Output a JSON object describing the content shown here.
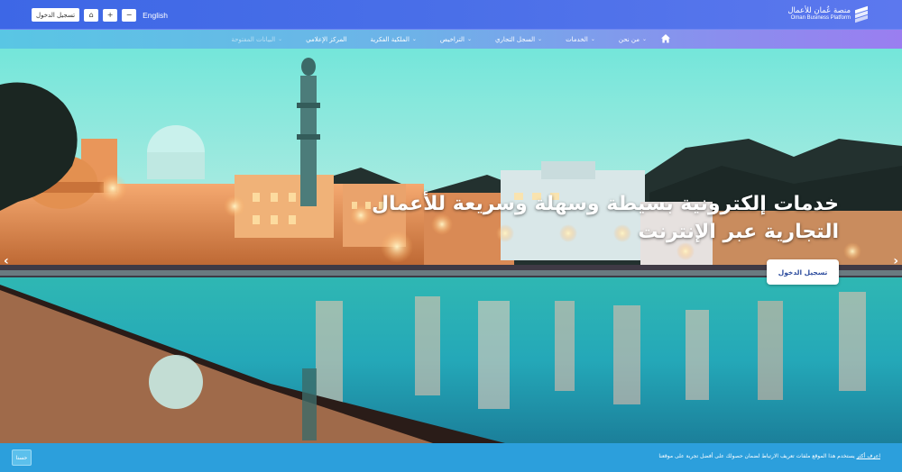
{
  "header": {
    "login_label": "تسجيل الدخول",
    "font_increase": "+",
    "font_decrease": "−",
    "home_small": "⌂",
    "language": "English",
    "logo_ar": "منصة عُمان للأعمال",
    "logo_en": "Oman Business Platform"
  },
  "nav": {
    "items": [
      {
        "label": "من نحن",
        "has_menu": true
      },
      {
        "label": "الخدمات",
        "has_menu": true
      },
      {
        "label": "السجل التجاري",
        "has_menu": true
      },
      {
        "label": "التراخيص",
        "has_menu": true
      },
      {
        "label": "الملكية الفكرية",
        "has_menu": true
      },
      {
        "label": "المركز الإعلامي",
        "has_menu": false
      },
      {
        "label": "البيانات المفتوحة",
        "has_menu": true
      }
    ]
  },
  "hero": {
    "title": "خدمات إلكترونية بسيطة وسهلة وسريعة للأعمال التجارية عبر الإنترنت",
    "cta_label": "تسجيل الدخول",
    "prev_arrow": "‹",
    "next_arrow": "›"
  },
  "cookie": {
    "text": "يستخدم هذا الموقع ملفات تعريف الارتباط لضمان حصولك على أفضل تجربة على موقعنا",
    "learn_more": "اعرف أكثر",
    "accept_label": "حسنا"
  },
  "colors": {
    "topbar": "#3d67e6",
    "cookiebar": "#2c9fdc",
    "cta_text": "#2d4c9e"
  },
  "icons": {
    "home": "home-icon",
    "chevron": "chevron-down-icon"
  }
}
